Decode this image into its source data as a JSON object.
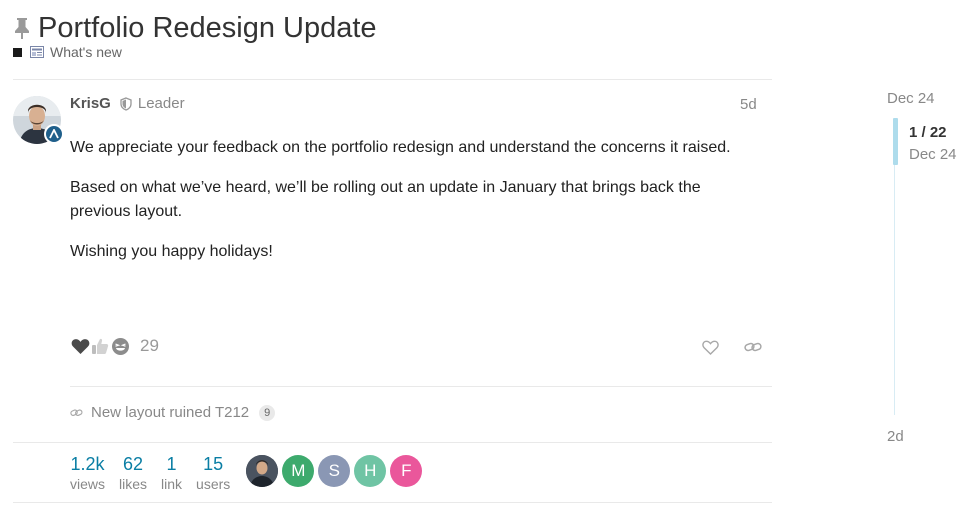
{
  "topic": {
    "title": "Portfolio Redesign Update",
    "category": "What's new"
  },
  "post": {
    "author": "KrisG",
    "role": "Leader",
    "age": "5d",
    "paragraphs": [
      "We appreciate your feedback on the portfolio redesign and understand the concerns it raised.",
      "Based on what we’ve heard, we’ll be rolling out an update in January that brings back the previous layout.",
      "Wishing you happy holidays!"
    ],
    "reaction_icons": [
      "heart-icon",
      "thumbs-up-icon",
      "laughing-face-icon"
    ],
    "reaction_count": "29"
  },
  "linked": {
    "title": "New layout ruined T212",
    "count": "9"
  },
  "stats": {
    "views": {
      "value": "1.2k",
      "label": "views"
    },
    "likes": {
      "value": "62",
      "label": "likes"
    },
    "links": {
      "value": "1",
      "label": "link"
    },
    "users": {
      "value": "15",
      "label": "users"
    }
  },
  "participants": [
    {
      "letter": "",
      "color": "#3a4450",
      "kind": "photo"
    },
    {
      "letter": "M",
      "color": "#3daa6d"
    },
    {
      "letter": "S",
      "color": "#8a97b4"
    },
    {
      "letter": "H",
      "color": "#6fc4a4"
    },
    {
      "letter": "F",
      "color": "#ea579b"
    }
  ],
  "timeline": {
    "top_date": "Dec 24",
    "position": "1 / 22",
    "position_date": "Dec 24",
    "bottom": "2d"
  },
  "colors": {
    "accent": "#0a7ea4",
    "timeline_handle": "#aedcec",
    "category_square": "#1a1a1a"
  }
}
